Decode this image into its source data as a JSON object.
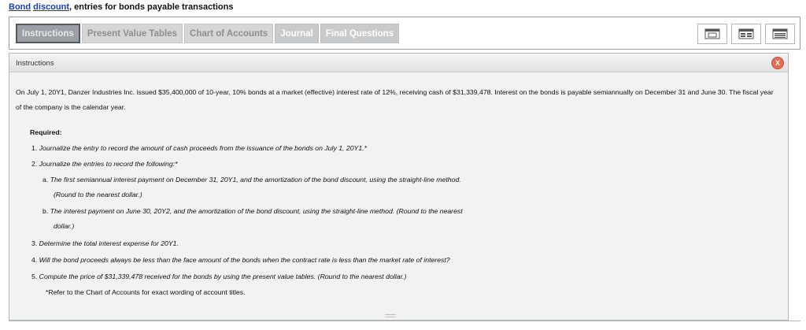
{
  "title": {
    "link1": "Bond",
    "link2": "discount",
    "rest": ", entries for bonds payable transactions"
  },
  "tabs": [
    {
      "label": "Instructions"
    },
    {
      "label": "Present Value Tables"
    },
    {
      "label": "Chart of Accounts"
    },
    {
      "label": "Journal"
    },
    {
      "label": "Final Questions"
    }
  ],
  "view_buttons": [
    {
      "icon": "single-window-icon"
    },
    {
      "icon": "split-view-icon"
    },
    {
      "icon": "stacked-view-icon"
    }
  ],
  "panel": {
    "header": "Instructions",
    "close": "X",
    "intro": "On July 1, 20Y1, Danzer Industries Inc. issued $35,400,000 of 10-year, 10% bonds at a market (effective) interest rate of 12%, receiving cash of $31,339,478. Interest on the bonds is payable semiannually on December 31 and June 30. The fiscal year of the company is the calendar year.",
    "required_label": "Required:",
    "items": {
      "i1": {
        "num": "1.",
        "text": "Journalize the entry to record the amount of cash proceeds from the issuance of the bonds on July 1, 20Y1.*"
      },
      "i2": {
        "num": "2.",
        "text": "Journalize the entries to record the following:*"
      },
      "ia": {
        "num": "a.",
        "line1": "The first semiannual interest payment on December 31, 20Y1, and the amortization of the bond discount, using the straight-line method.",
        "line2": "(Round to the nearest dollar.)"
      },
      "ib": {
        "num": "b.",
        "line1": "The interest payment on June 30, 20Y2, and the amortization of the bond discount, using the straight-line method. (Round to the nearest",
        "line2": "dollar.)"
      },
      "i3": {
        "num": "3.",
        "text": "Determine the total interest expense for 20Y1."
      },
      "i4": {
        "num": "4.",
        "text": "Will the bond proceeds always be less than the face amount of the bonds when the contract rate is less than the market rate of interest?"
      },
      "i5": {
        "num": "5.",
        "text": "Compute the price of $31,339,478 received for the bonds by using the present value tables. (Round to the nearest dollar.)"
      }
    },
    "footnote": "*Refer to the Chart of Accounts for exact wording of account titles."
  }
}
